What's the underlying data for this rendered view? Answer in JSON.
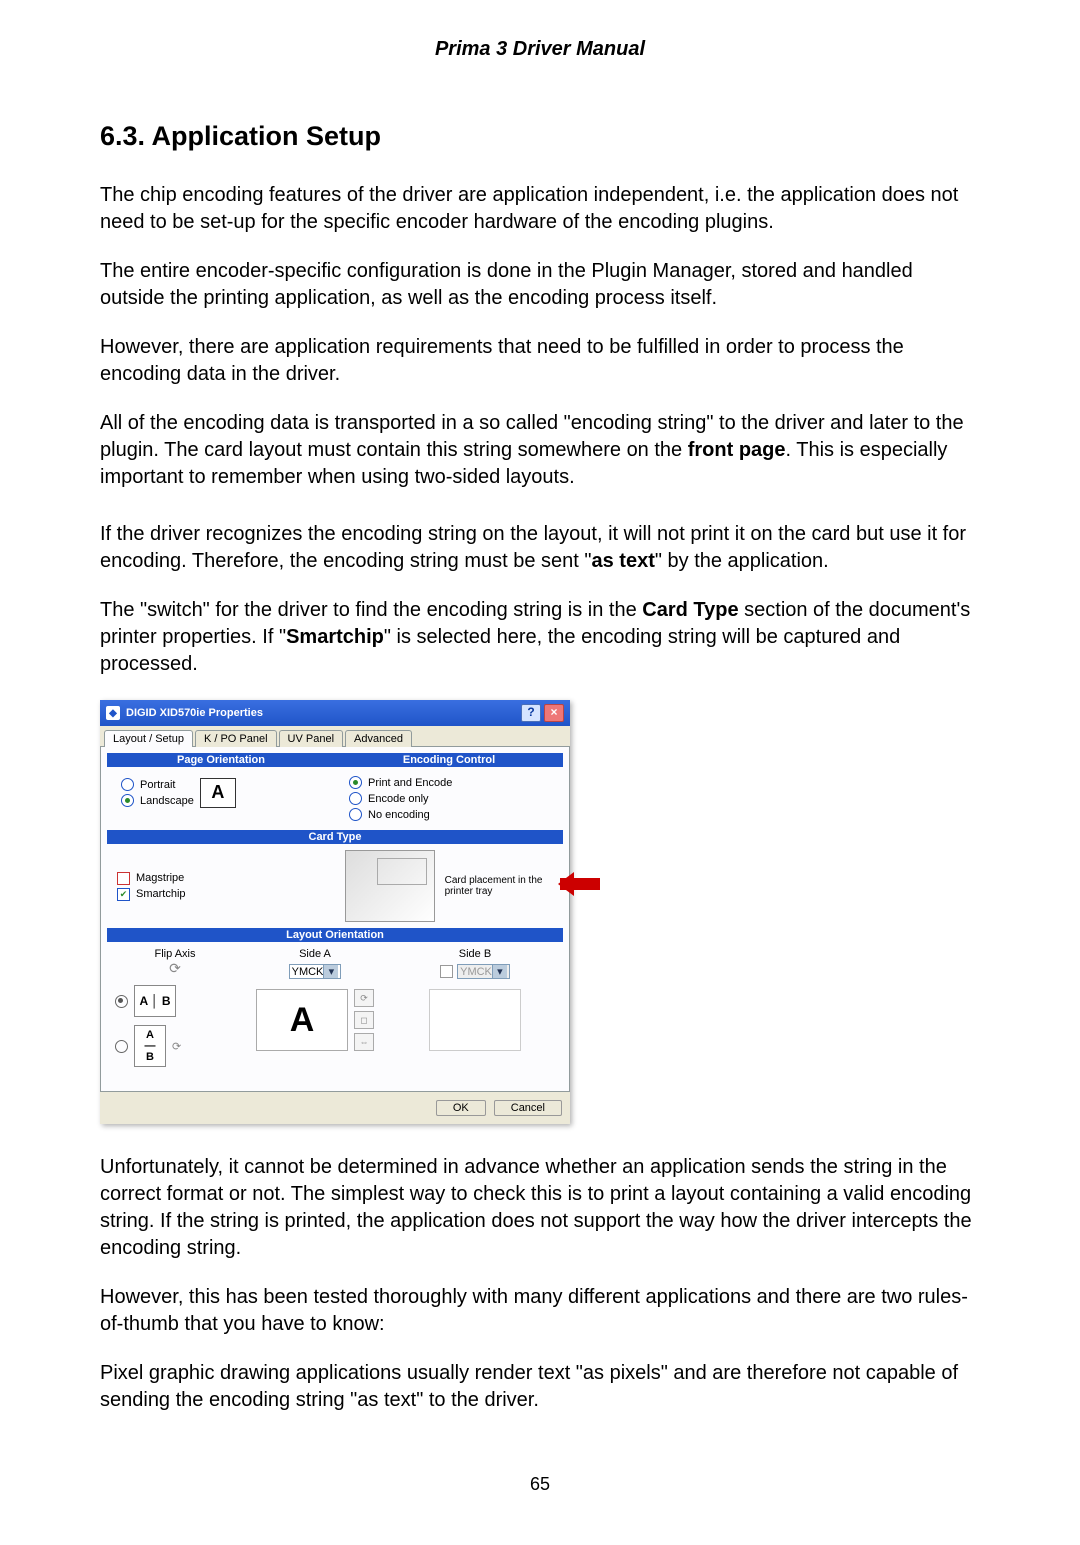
{
  "doc_header": "Prima 3 Driver Manual",
  "section_heading": "6.3.   Application Setup",
  "para1": "The chip encoding features of the driver are application independent, i.e. the application does not need to be set-up for the specific encoder hardware of the encoding plugins.",
  "para2": "The entire encoder-specific configuration is done in the Plugin Manager, stored and handled outside the printing application, as well as the encoding process itself.",
  "para3": "However, there are application requirements that need to be fulfilled in order to process the encoding data in the driver.",
  "para4a": "All of the encoding data is transported in a so called \"encoding string\" to the driver and later to the plugin. The card layout must contain this string somewhere on the ",
  "para4b": "front page",
  "para4c": ". This is especially important to remember when using two-sided layouts.",
  "para5a": "If the driver recognizes the encoding string on the layout, it will not print it on the card but use it for encoding. Therefore, the encoding string must be sent \"",
  "para5b": "as text",
  "para5c": "\" by the application.",
  "para6a": "The \"switch\" for the driver to find the encoding string is in the ",
  "para6b": "Card Type",
  "para6c": " section of the document's printer properties. If \"",
  "para6d": "Smartchip",
  "para6e": "\" is selected here, the encoding string will be captured and processed.",
  "para7": "Unfortunately, it cannot be determined in advance whether an application sends the string in the correct format or not. The simplest way to check this is to print a layout containing a valid encoding string. If the string is printed, the application does not support the way how the driver intercepts the encoding string.",
  "para8": "However, this has been tested thoroughly with many different applications and there are two rules-of-thumb that you have to know:",
  "para9": "Pixel graphic drawing applications usually render text \"as pixels\" and are therefore not capable of sending the encoding string \"as text\" to the driver.",
  "page_number": "65",
  "dialog": {
    "title": "DIGID XID570ie Properties",
    "tabs": [
      "Layout / Setup",
      "K / PO Panel",
      "UV Panel",
      "Advanced"
    ],
    "page_orientation": {
      "band": "Page Orientation",
      "portrait": "Portrait",
      "landscape": "Landscape",
      "icon_letter": "A"
    },
    "encoding_control": {
      "band": "Encoding Control",
      "opt1": "Print and Encode",
      "opt2": "Encode only",
      "opt3": "No encoding"
    },
    "card_type": {
      "band": "Card Type",
      "magstripe": "Magstripe",
      "smartchip": "Smartchip",
      "placement": "Card placement in the printer tray"
    },
    "layout": {
      "band": "Layout Orientation",
      "flip": "Flip Axis",
      "sideA": "Side A",
      "sideB": "Side B",
      "ymck": "YMCK",
      "previewA": "A"
    },
    "ok": "OK",
    "cancel": "Cancel"
  }
}
